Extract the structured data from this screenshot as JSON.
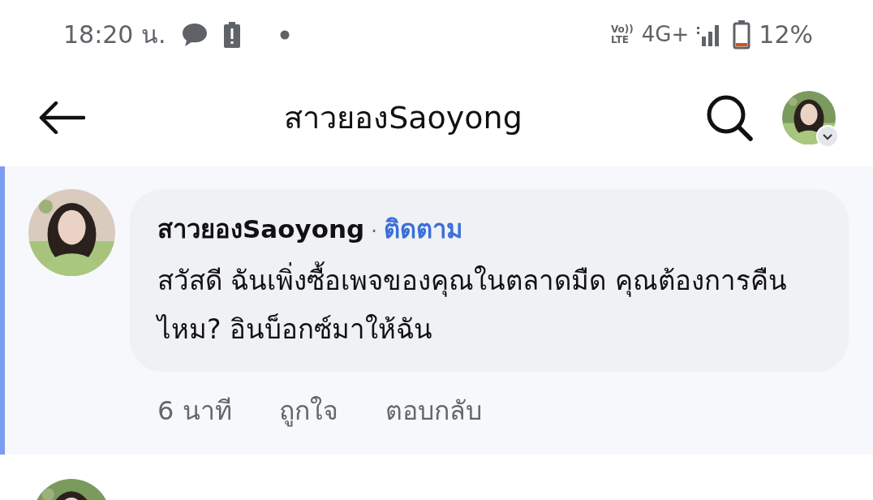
{
  "status_bar": {
    "time": "18:20 น.",
    "volte_lines": [
      "Vo))",
      "LTE"
    ],
    "network": "4G+",
    "battery": "12%"
  },
  "header": {
    "title": "สาวยองSaoyong"
  },
  "comments": [
    {
      "author": "สาวยองSaoyong",
      "separator": "·",
      "follow": "ติดตาม",
      "highlighted": true,
      "text": "สวัสดี ฉันเพิ่งซื้อเพจของคุณในตลาดมืด คุณต้องการคืนไหม? อินบ็อกซ์มาให้ฉัน",
      "time": "6 นาที",
      "like": "ถูกใจ",
      "reply": "ตอบกลับ"
    }
  ]
}
